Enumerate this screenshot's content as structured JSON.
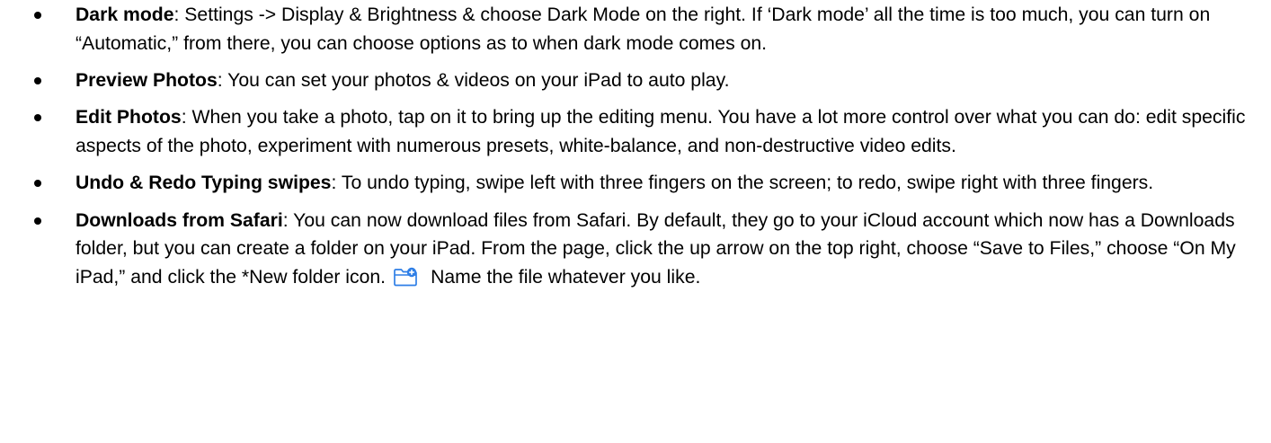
{
  "bullets": [
    {
      "term": "Dark mode",
      "text": ": Settings -> Display & Brightness & choose Dark Mode on the right. If ‘Dark mode’ all the time is too much, you can turn on “Automatic,” from there, you can choose options as to when dark mode comes on."
    },
    {
      "term": "Preview Photos",
      "text": ": You can set your photos & videos on your iPad to auto play."
    },
    {
      "term": "Edit Photos",
      "text": ": When you take a photo, tap on it to bring up the editing menu. You have a lot more control over what you can do: edit specific aspects of the photo, experiment with numerous presets, white-balance, and non-destructive video edits."
    },
    {
      "term": "Undo & Redo Typing swipes",
      "text": ": To undo typing, swipe left with three fingers on the screen; to redo, swipe right with three fingers."
    },
    {
      "term": "Downloads from Safari",
      "text_before_icon": ": You can now download files from Safari. By default, they go to your iCloud account which now has a Downloads folder, but you can create a folder on your iPad. From the page, click the up arrow on the top right, choose “Save to Files,” choose “On My iPad,” and click the *New folder icon.",
      "icon": "new-folder-icon",
      "text_after_icon": "Name the file whatever you like."
    }
  ],
  "colors": {
    "text": "#000000",
    "icon": "#2f7fe6",
    "background": "#ffffff"
  }
}
